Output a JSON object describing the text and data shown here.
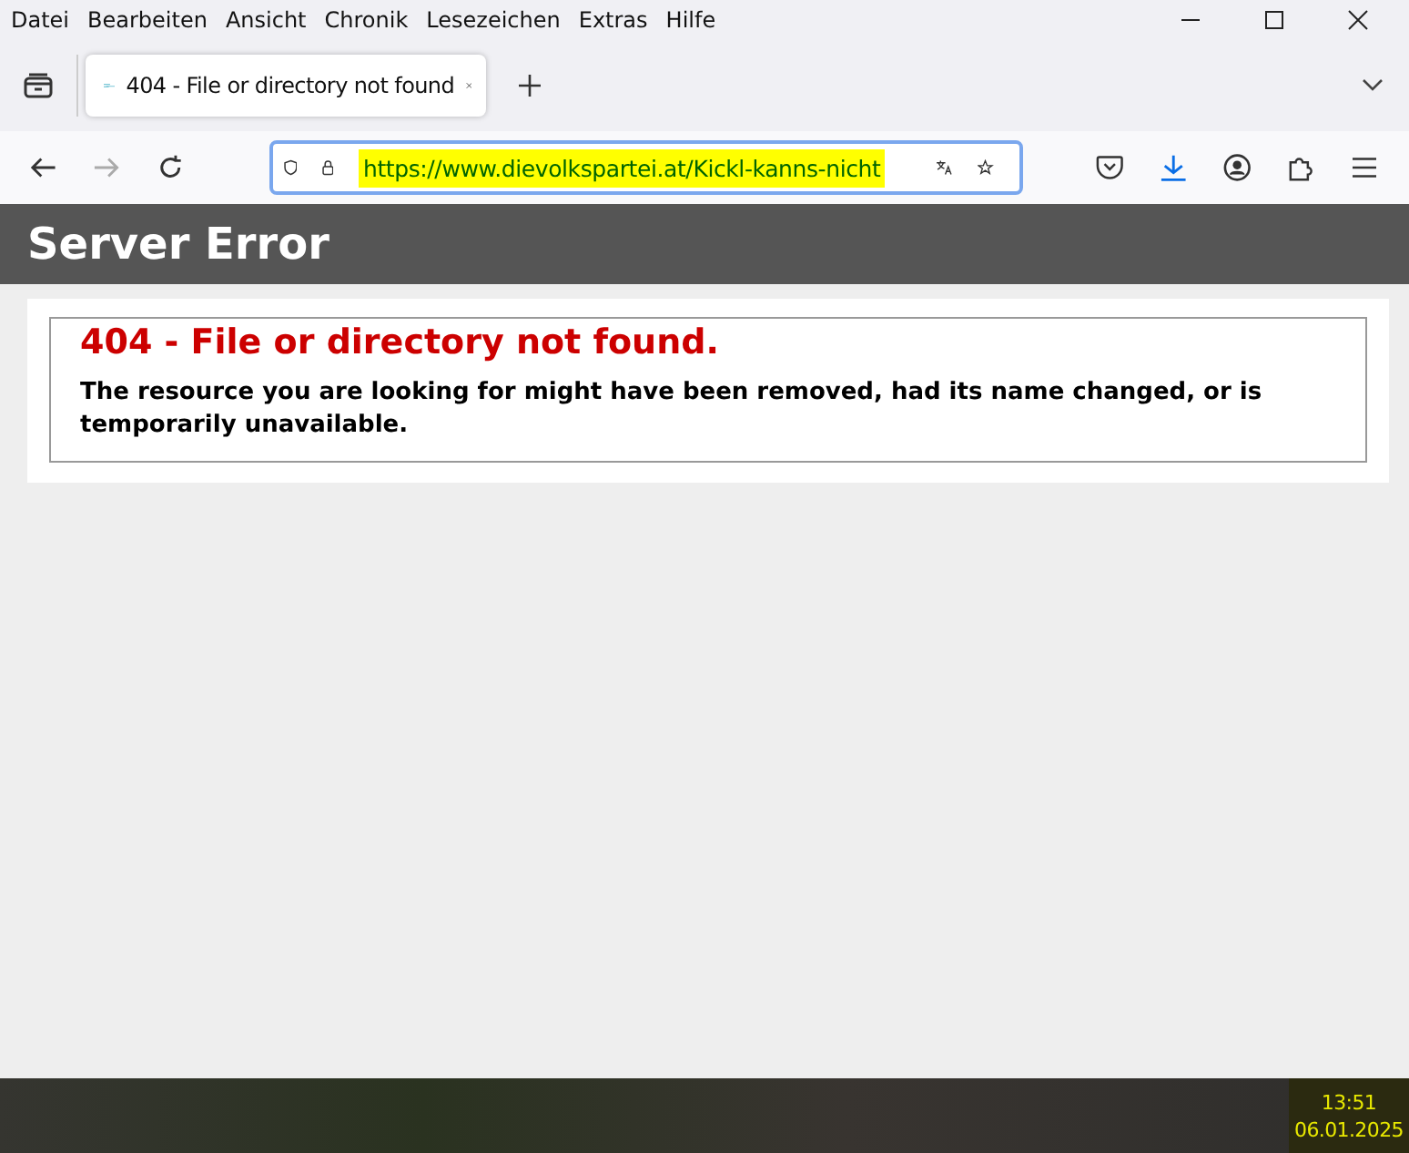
{
  "menu": [
    "Datei",
    "Bearbeiten",
    "Ansicht",
    "Chronik",
    "Lesezeichen",
    "Extras",
    "Hilfe"
  ],
  "tabs": [
    {
      "title": "404 - File or directory not found",
      "selected": true
    }
  ],
  "address_bar": {
    "url": "https://www.dievolkspartei.at/Kickl-kanns-nicht",
    "selected": true
  },
  "page": {
    "header": "Server Error",
    "error_title": "404 - File or directory not found.",
    "error_message": "The resource you are looking for might have been removed, had its name changed, or is temporarily unavailable."
  },
  "taskbar": {
    "time": "13:51",
    "date": "06.01.2025"
  }
}
